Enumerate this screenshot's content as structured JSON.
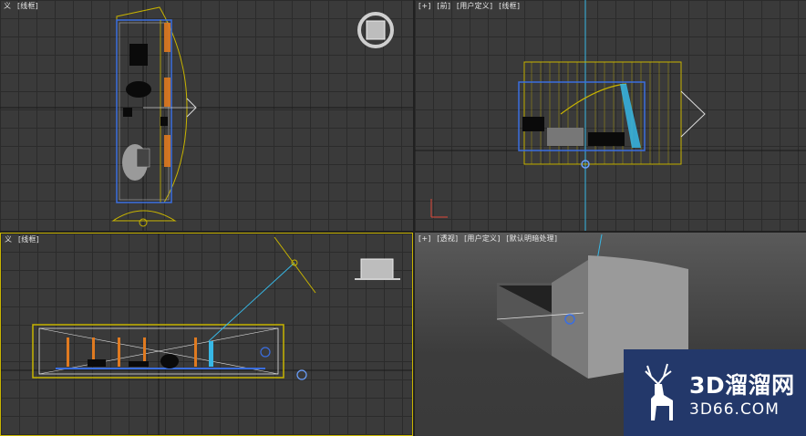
{
  "viewports": {
    "top": {
      "labels": [
        "义",
        "[线框]"
      ]
    },
    "front": {
      "labels": [
        "[+]",
        "[前]",
        "[用户定义]",
        "[线框]"
      ]
    },
    "left": {
      "labels": [
        "义",
        "[线框]"
      ]
    },
    "perspective": {
      "labels": [
        "[+]",
        "[透视]",
        "[用户定义]",
        "[默认明暗处理]"
      ]
    }
  },
  "watermark": {
    "brand": "3D溜溜网",
    "domain": "3D66.COM",
    "icon": "deer-logo-icon"
  },
  "colors": {
    "grid_bg": "#3a3a3a",
    "selection_yellow": "#c8b400",
    "light_cyan": "#37b8e6",
    "wire_orange": "#e07a20",
    "watermark_bg": "#23386a"
  }
}
